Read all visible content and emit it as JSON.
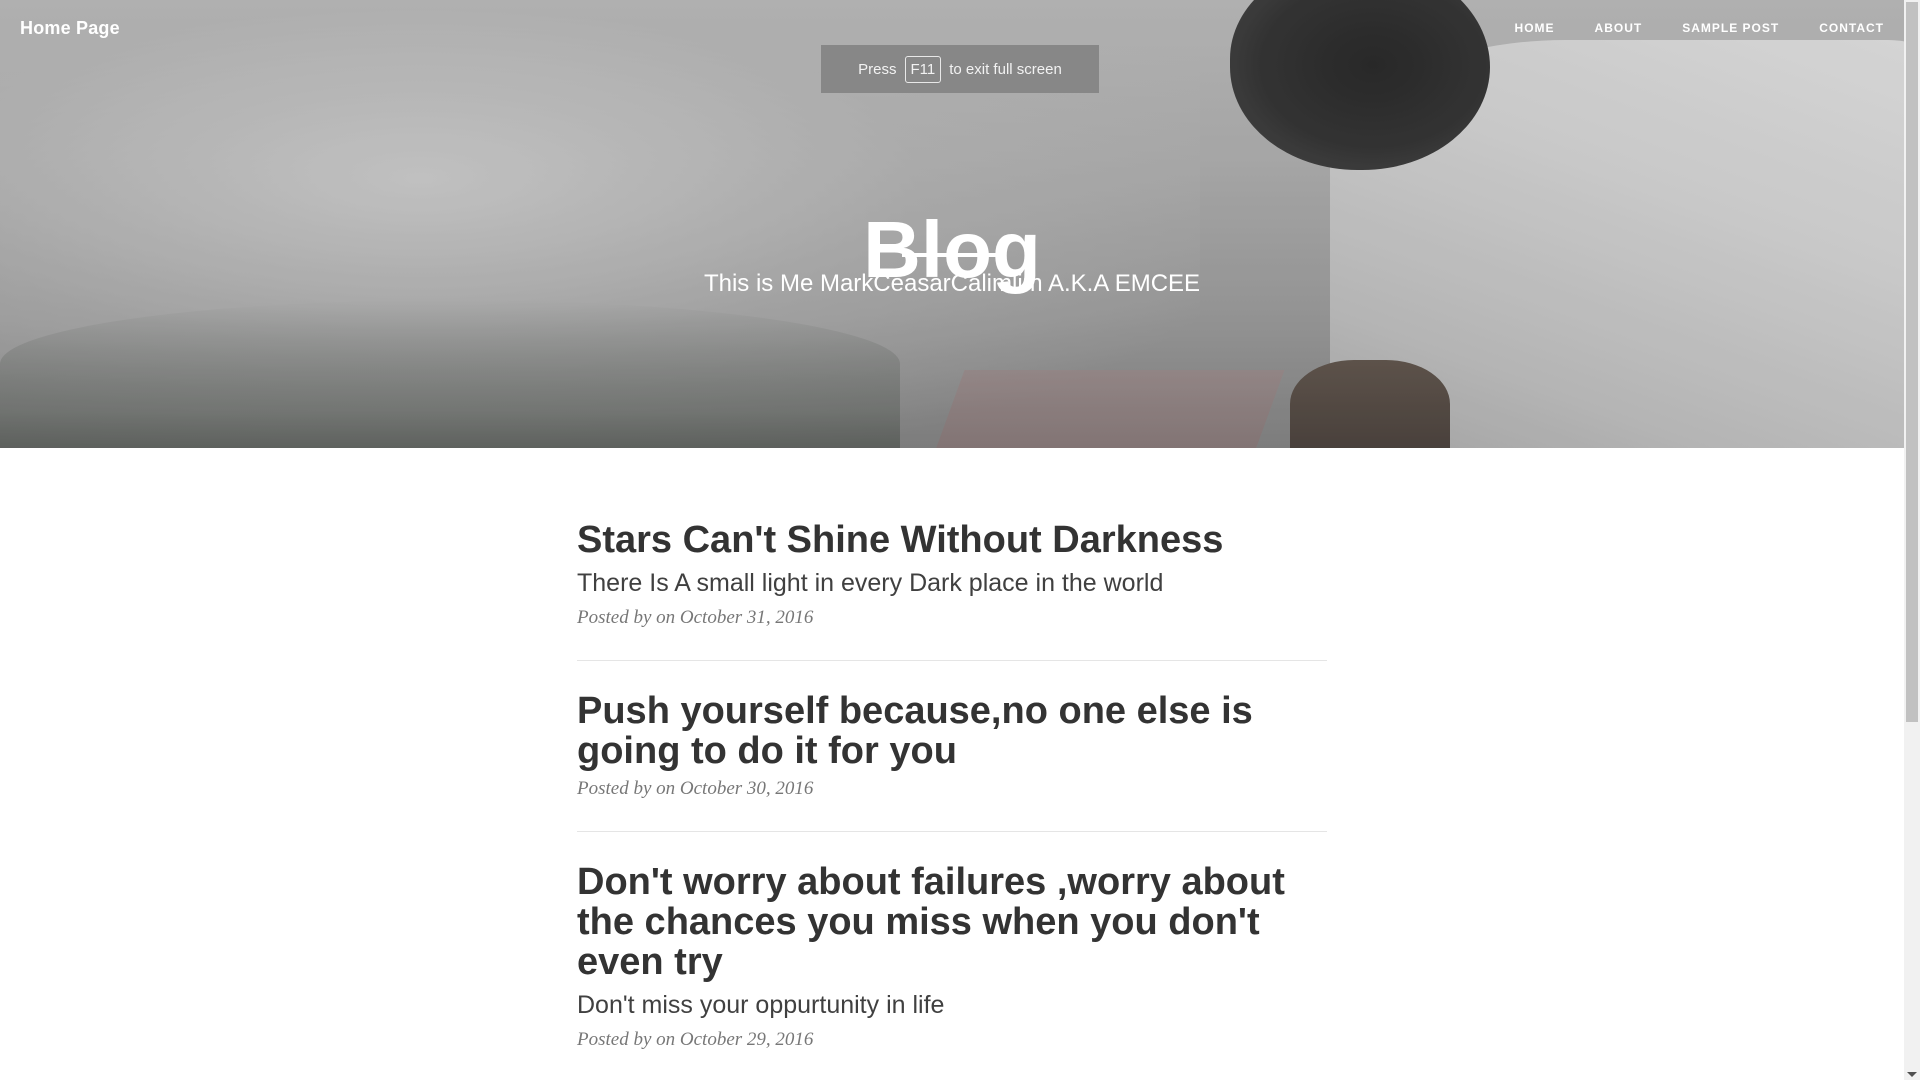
{
  "navbar": {
    "brand": "Home Page",
    "links": [
      {
        "label": "HOME"
      },
      {
        "label": "ABOUT"
      },
      {
        "label": "SAMPLE POST"
      },
      {
        "label": "CONTACT"
      }
    ]
  },
  "fullscreen_notice": {
    "prefix": "Press",
    "key": "F11",
    "suffix": "to exit full screen"
  },
  "hero": {
    "title": "Blog",
    "subtitle": "This is Me MarkCeasarCalimlim A.K.A EMCEE"
  },
  "posts": [
    {
      "title": "Stars Can't Shine Without Darkness",
      "subtitle": "There Is A small light in every Dark place in the world",
      "meta": "Posted by on October 31, 2016"
    },
    {
      "title": "Push yourself because,no one else is going to do it for you",
      "subtitle": "",
      "meta": "Posted by on October 30, 2016"
    },
    {
      "title": "Don't worry about failures ,worry about the chances you miss when you don't even try",
      "subtitle": "Don't miss your oppurtunity in life",
      "meta": "Posted by on October 29, 2016"
    }
  ]
}
